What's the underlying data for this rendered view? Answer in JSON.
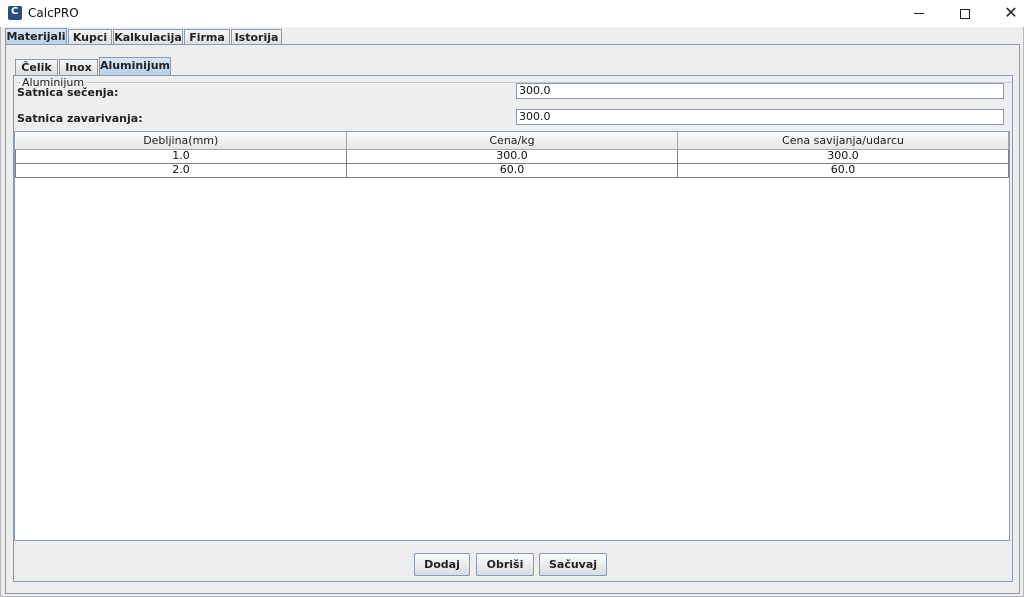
{
  "window": {
    "title": "CalcPRO",
    "controls": [
      "minimize-icon",
      "maximize-icon",
      "close-icon"
    ]
  },
  "main_tabs": [
    {
      "label": "Materijali",
      "selected": true
    },
    {
      "label": "Kupci",
      "selected": false
    },
    {
      "label": "Kalkulacija",
      "selected": false
    },
    {
      "label": "Firma",
      "selected": false
    },
    {
      "label": "Istorija",
      "selected": false
    }
  ],
  "material_tabs": [
    {
      "label": "Čelik",
      "selected": false
    },
    {
      "label": "Inox",
      "selected": false
    },
    {
      "label": "Aluminijum",
      "selected": true
    }
  ],
  "panel": {
    "group_title": "Aluminijum",
    "cutting_rate_label": "Satnica sečenja:",
    "cutting_rate_value": "300.0",
    "welding_rate_label": "Satnica zavarivanja:",
    "welding_rate_value": "300.0"
  },
  "table": {
    "columns": [
      "Debljina(mm)",
      "Cena/kg",
      "Cena savijanja/udarcu"
    ],
    "rows": [
      [
        "1.0",
        "300.0",
        "300.0"
      ],
      [
        "2.0",
        "60.0",
        "60.0"
      ]
    ]
  },
  "buttons": {
    "add": "Dodaj",
    "delete": "Obriši",
    "save": "Sačuvaj"
  },
  "colors": {
    "selected_tab": "#b8cde4",
    "border": "#8a9ab0",
    "background": "#eeeeee"
  }
}
